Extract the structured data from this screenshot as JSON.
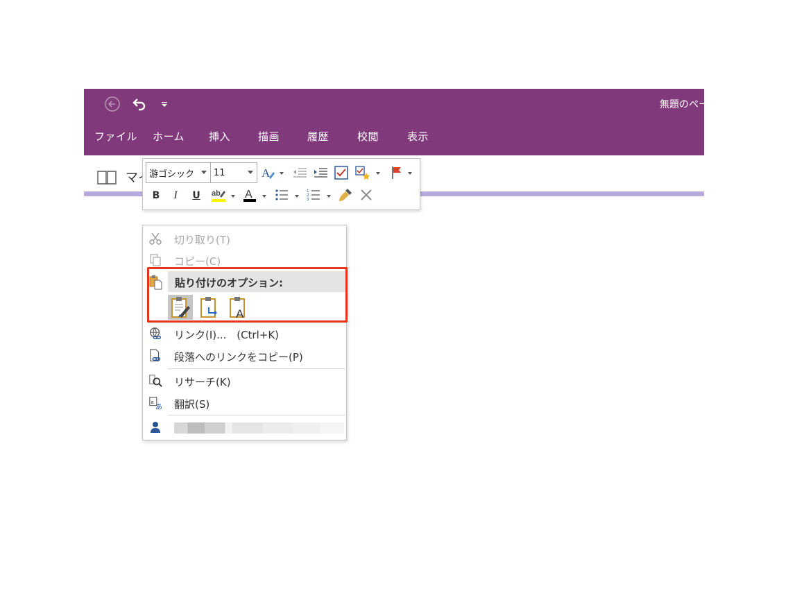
{
  "window": {
    "doc_title": "無題のページ"
  },
  "menubar": {
    "tabs": [
      "ファイル",
      "ホーム",
      "挿入",
      "描画",
      "履歴",
      "校閲",
      "表示"
    ]
  },
  "notebook": {
    "name": "マイノートブック"
  },
  "mini_toolbar": {
    "font_name": "游ゴシック",
    "font_size": "11",
    "bold_label": "B",
    "italic_label": "I",
    "underline_label": "U"
  },
  "context_menu": {
    "cut": "切り取り(T)",
    "copy": "コピー(C)",
    "paste_options_header": "貼り付けのオプション:",
    "link": "リンク(I)...",
    "link_shortcut": "(Ctrl+K)",
    "copy_paragraph_link": "段落へのリンクをコピー(P)",
    "research": "リサーチ(K)",
    "translate": "翻訳(S)"
  },
  "colors": {
    "title_bar": "#80397b",
    "section_strip": "#b6a9dc",
    "highlight_box": "#e8321c"
  }
}
